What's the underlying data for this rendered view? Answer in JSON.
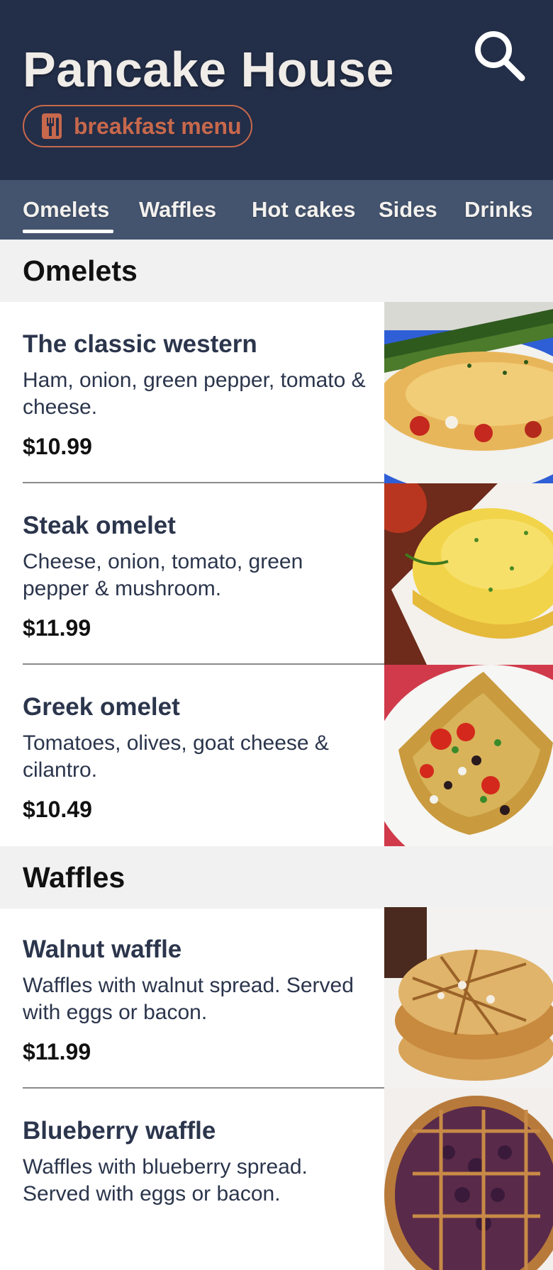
{
  "header": {
    "title": "Pancake House",
    "badge_label": "breakfast menu",
    "badge_icon": "fork-knife-icon",
    "search_icon": "search-icon"
  },
  "tabs": [
    {
      "label": "Omelets",
      "active": true
    },
    {
      "label": "Waffles",
      "active": false
    },
    {
      "label": "Hot cakes",
      "active": false
    },
    {
      "label": "Sides",
      "active": false
    },
    {
      "label": "Drinks",
      "active": false
    }
  ],
  "sections": [
    {
      "title": "Omelets",
      "items": [
        {
          "name": "The classic western",
          "description": "Ham, onion, green pepper, tomato & cheese.",
          "price": "$10.99"
        },
        {
          "name": "Steak omelet",
          "description": "Cheese, onion, tomato, green pepper & mushroom.",
          "price": "$11.99"
        },
        {
          "name": "Greek omelet",
          "description": "Tomatoes, olives, goat cheese & cilantro.",
          "price": "$10.49"
        }
      ]
    },
    {
      "title": "Waffles",
      "items": [
        {
          "name": "Walnut waffle",
          "description": "Waffles with walnut spread. Served with eggs or bacon.",
          "price": "$11.99"
        },
        {
          "name": "Blueberry waffle",
          "description": "Waffles with blueberry spread. Served with eggs or bacon.",
          "price": ""
        }
      ]
    }
  ],
  "colors": {
    "header_bg": "#232e48",
    "tab_bar_bg": "#44546f",
    "accent": "#c7684c",
    "section_bg": "#f1f1f1"
  }
}
